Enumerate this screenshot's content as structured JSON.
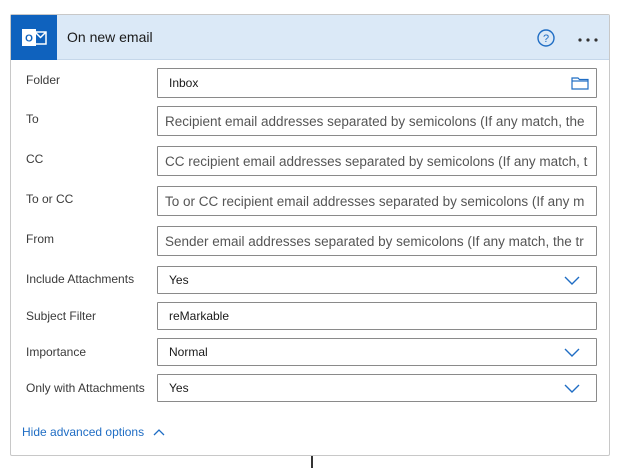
{
  "header": {
    "title": "On new email",
    "logo_icon": "outlook-icon",
    "help_icon": "help-icon",
    "more_icon": "more-icon",
    "accent_color": "#0f62be",
    "header_bg": "#dbe9f7"
  },
  "fields": {
    "folder": {
      "label": "Folder",
      "value": "Inbox",
      "icon": "folder-icon"
    },
    "to": {
      "label": "To",
      "placeholder": "Recipient email addresses separated by semicolons (If any match, the"
    },
    "cc": {
      "label": "CC",
      "placeholder": "CC recipient email addresses separated by semicolons (If any match, t"
    },
    "to_or_cc": {
      "label": "To or CC",
      "placeholder": "To or CC recipient email addresses separated by semicolons (If any m"
    },
    "from": {
      "label": "From",
      "placeholder": "Sender email addresses separated by semicolons (If any match, the tr"
    },
    "include_attachments": {
      "label": "Include Attachments",
      "value": "Yes"
    },
    "subject_filter": {
      "label": "Subject Filter",
      "value": "reMarkable"
    },
    "importance": {
      "label": "Importance",
      "value": "Normal"
    },
    "only_with_attachments": {
      "label": "Only with Attachments",
      "value": "Yes"
    }
  },
  "advanced": {
    "label": "Hide advanced options",
    "link_color": "#1f6dc4"
  }
}
